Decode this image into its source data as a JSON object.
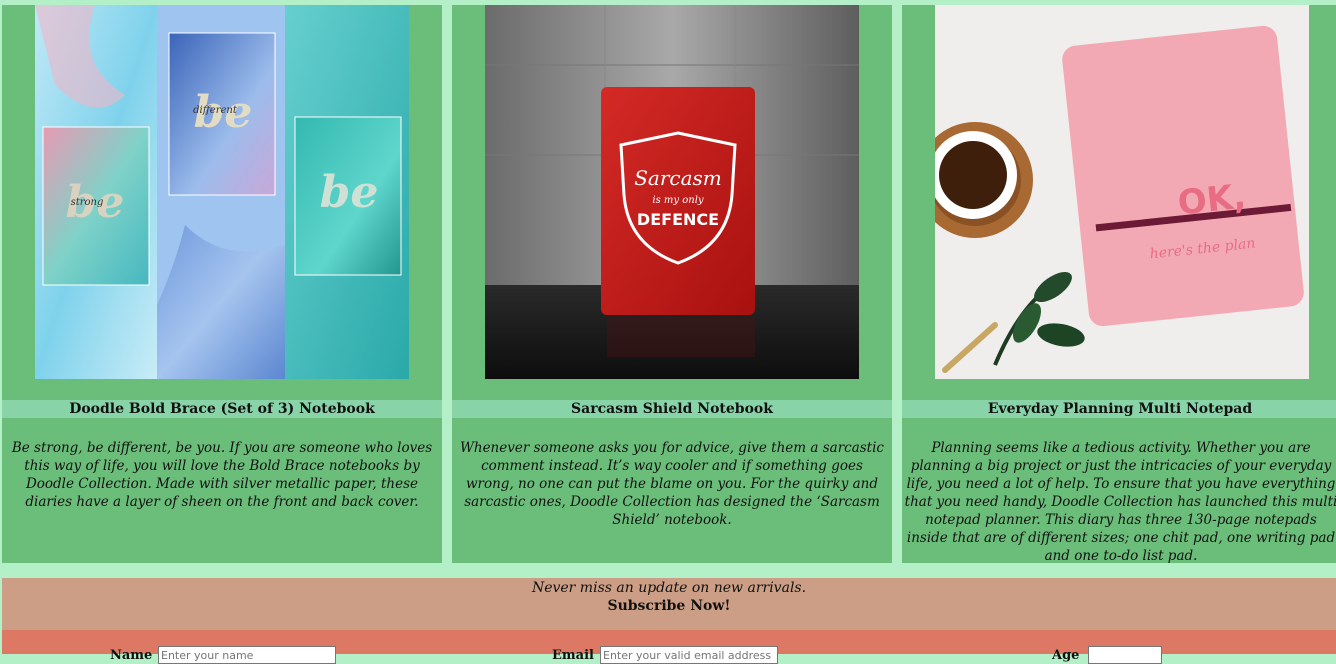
{
  "products": [
    {
      "name": "Doodle Bold Brace (Set of 3) Notebook",
      "description": "Be strong, be different, be you. If you are someone who loves this way of life, you will love the Bold Brace notebooks by Doodle Collection. Made with silver metallic paper, these diaries have a layer of sheen on the front and back cover.",
      "image_text": [
        "be",
        "different",
        "be",
        "strong",
        "be"
      ]
    },
    {
      "name": "Sarcasm Shield Notebook",
      "description": "Whenever someone asks you for advice, give them a sarcastic comment instead. It’s way cooler and if something goes wrong, no one can put the blame on you. For the quirky and sarcastic ones, Doodle Collection has designed the ‘Sarcasm Shield’ notebook.",
      "image_text": [
        "Sarcasm",
        "is my only",
        "DEFENCE"
      ]
    },
    {
      "name": "Everyday Planning Multi Notepad",
      "description": "Planning seems like a tedious activity. Whether you are planning a big project or just the intricacies of your everyday life, you need a lot of help. To ensure that you have everything that you need handy, Doodle Collection has launched this multi notepad planner. This diary has three 130-page notepads inside that are of different sizes; one chit pad, one writing pad and one to-do list pad.",
      "image_text": [
        "OK,",
        "here's the plan"
      ]
    }
  ],
  "subscribe": {
    "tagline": "Never miss an update on new arrivals.",
    "cta": "Subscribe Now!"
  },
  "form": {
    "name_label": "Name",
    "name_placeholder": "Enter your name",
    "email_label": "Email",
    "email_placeholder": "Enter your valid email address",
    "age_label": "Age",
    "age_placeholder": ""
  },
  "colors": {
    "page_bg": "#b3f0c8",
    "card_bg": "#6bbd7a",
    "title_bar": "#88d3a7",
    "subscribe_bg": "#cc9e85",
    "form_bg": "#dc7863"
  }
}
